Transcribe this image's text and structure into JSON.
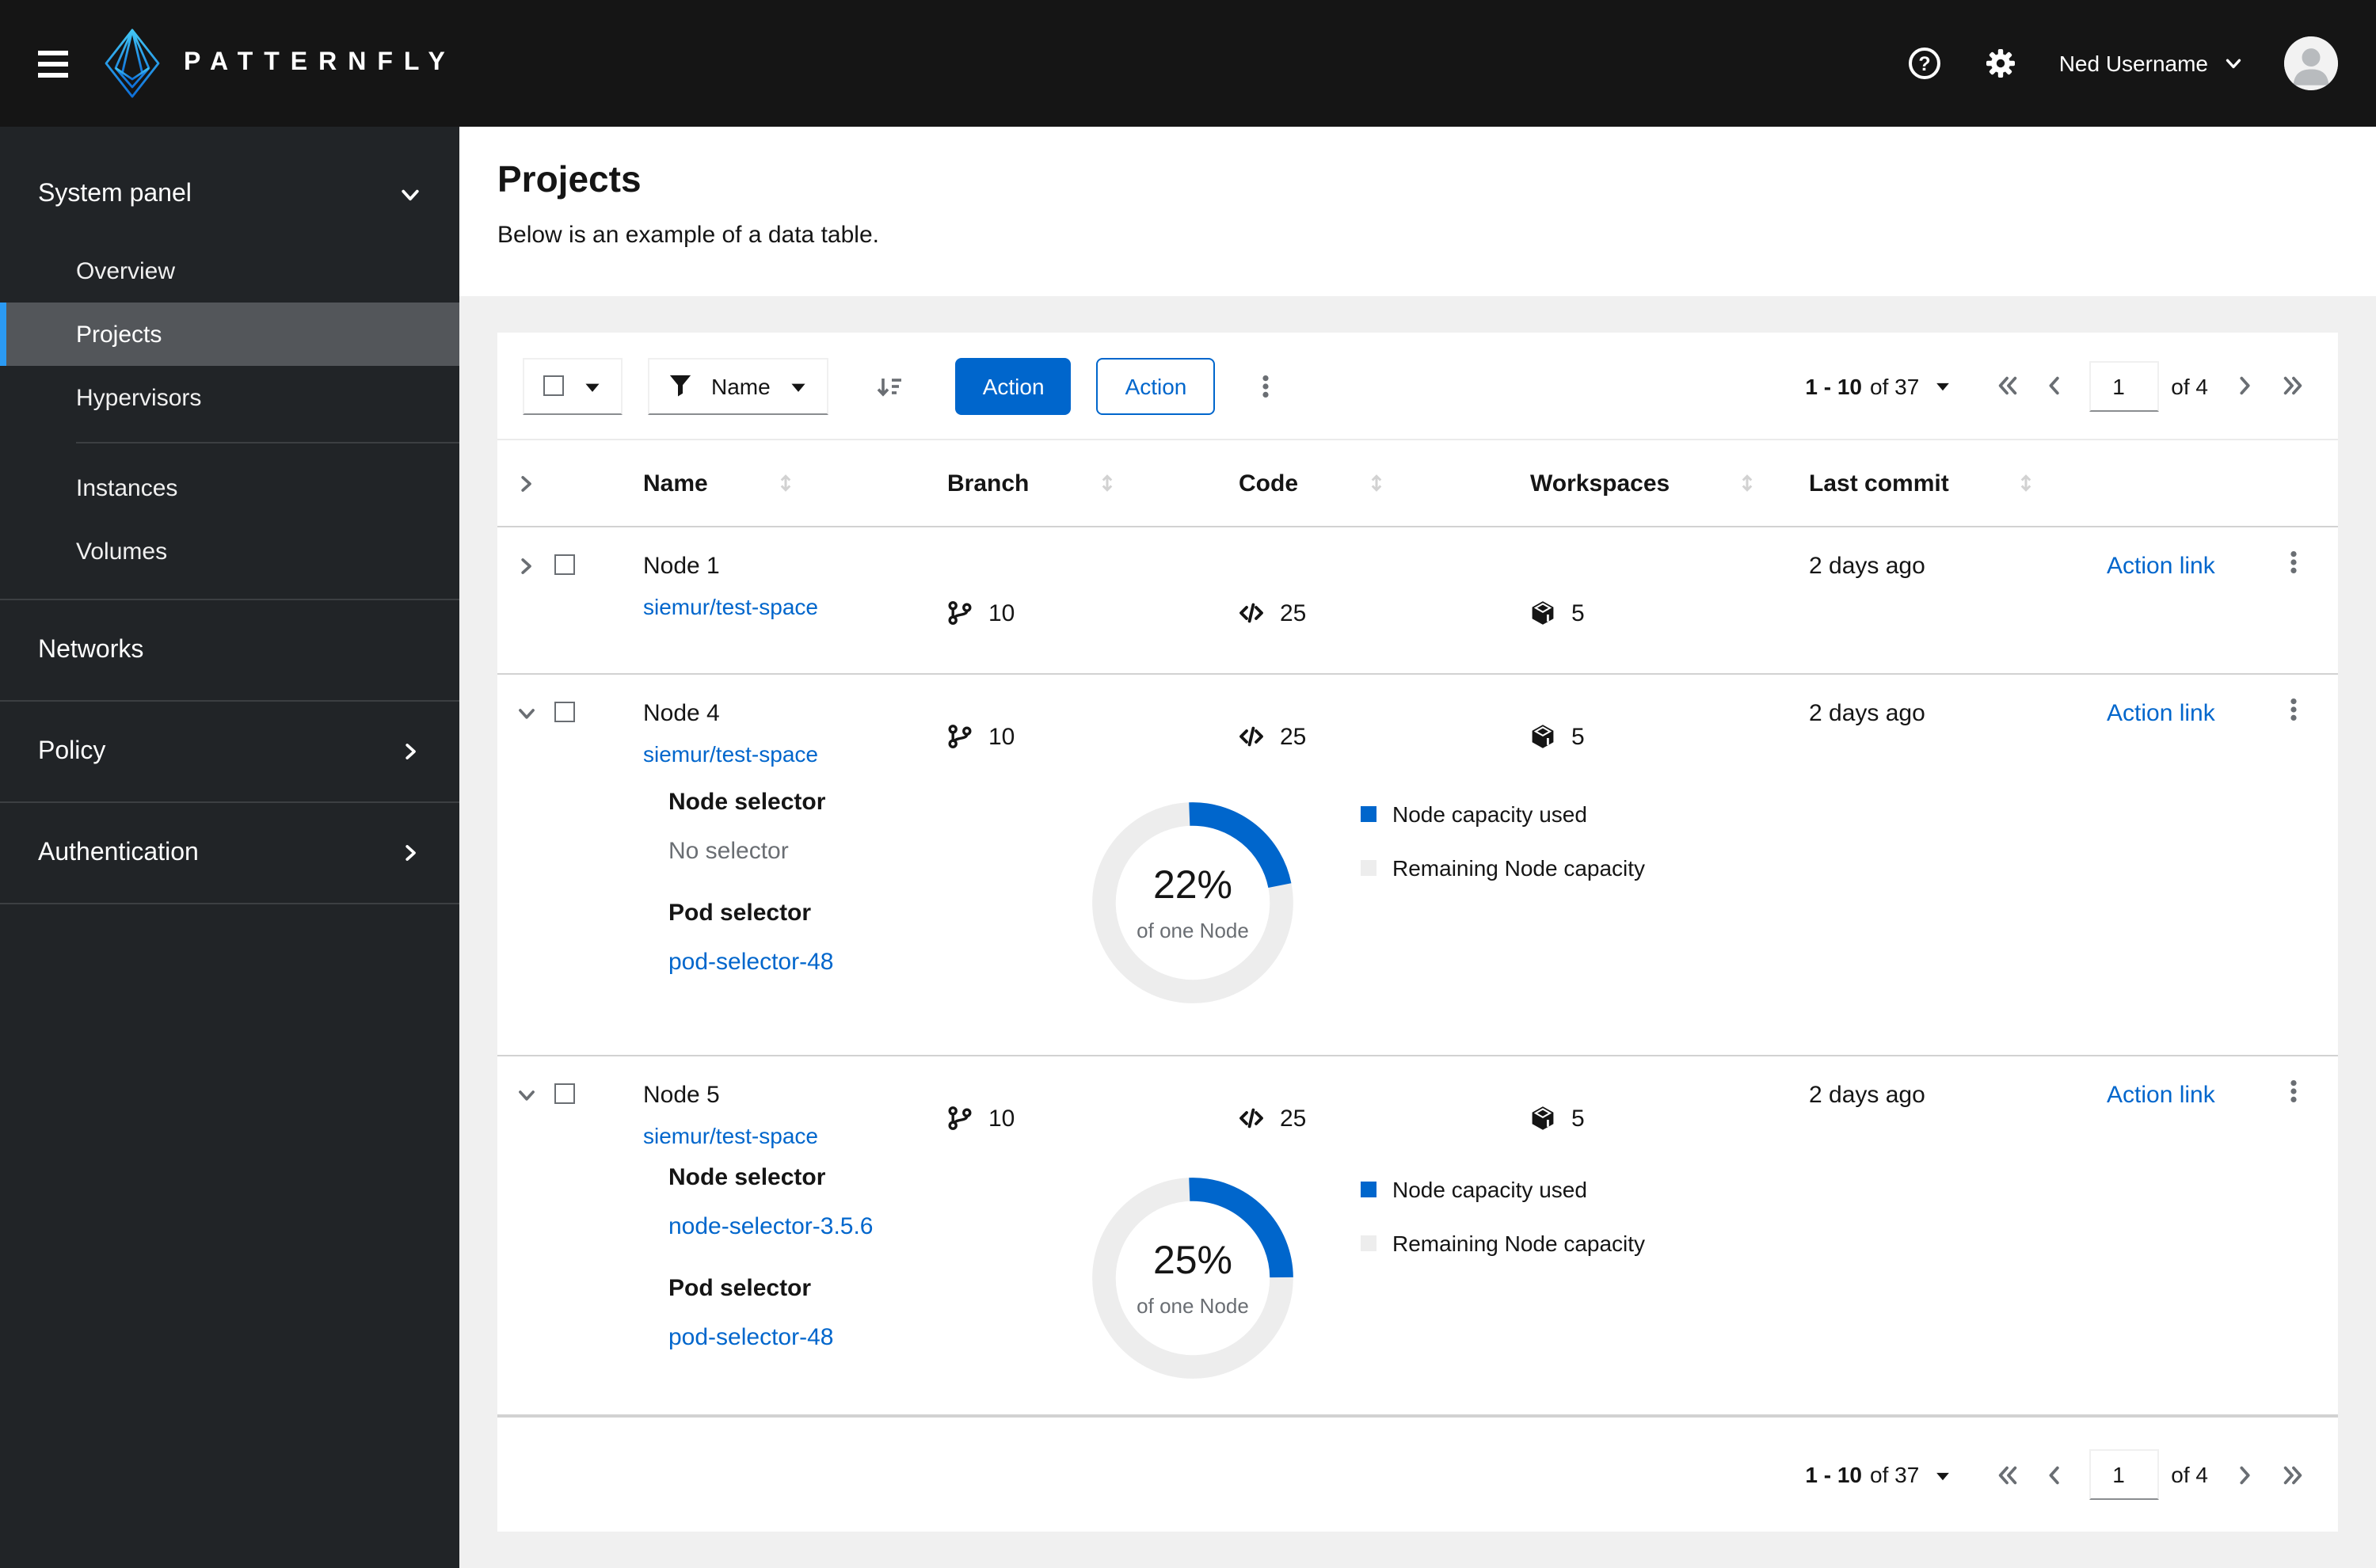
{
  "masthead": {
    "brand": "PATTERNFLY",
    "username": "Ned Username"
  },
  "sidebar": {
    "system_panel": "System panel",
    "items": [
      "Overview",
      "Projects",
      "Hypervisors",
      "Instances",
      "Volumes"
    ],
    "networks": "Networks",
    "policy": "Policy",
    "authentication": "Authentication"
  },
  "page": {
    "title": "Projects",
    "subtitle": "Below is an example of a data table."
  },
  "toolbar": {
    "filter_label": "Name",
    "action_primary": "Action",
    "action_secondary": "Action"
  },
  "pagination": {
    "range": "1 - 10",
    "total": "of 37",
    "page_value": "1",
    "pages": "of 4"
  },
  "table": {
    "columns": [
      "Name",
      "Branch",
      "Code",
      "Workspaces",
      "Last commit"
    ],
    "rows": [
      {
        "name": "Node 1",
        "link": "siemur/test-space",
        "branch": "10",
        "code": "25",
        "workspaces": "5",
        "commit": "2 days ago",
        "action": "Action link"
      },
      {
        "name": "Node 4",
        "link": "siemur/test-space",
        "branch": "10",
        "code": "25",
        "workspaces": "5",
        "commit": "2 days ago",
        "action": "Action link",
        "details": {
          "selector_label": "Node selector",
          "selector_value": "No selector",
          "pod_label": "Pod selector",
          "pod_value": "pod-selector-48",
          "donut_percent": 22,
          "donut_value": "22%",
          "donut_sub": "of one Node",
          "legend_used": "Node capacity used",
          "legend_remaining": "Remaining Node capacity"
        }
      },
      {
        "name": "Node 5",
        "link": "siemur/test-space",
        "branch": "10",
        "code": "25",
        "workspaces": "5",
        "commit": "2 days ago",
        "action": "Action link",
        "details": {
          "selector_label": "Node selector",
          "selector_value": "node-selector-3.5.6",
          "pod_label": "Pod selector",
          "pod_value": "pod-selector-48",
          "donut_percent": 25,
          "donut_value": "25%",
          "donut_sub": "of one Node",
          "legend_used": "Node capacity used",
          "legend_remaining": "Remaining Node capacity"
        }
      }
    ]
  },
  "colors": {
    "primary": "#0066cc",
    "donut_track": "#ededed",
    "nav_accent": "#2b9af3",
    "masthead_bg": "#151515",
    "sidebar_bg": "#212427"
  }
}
